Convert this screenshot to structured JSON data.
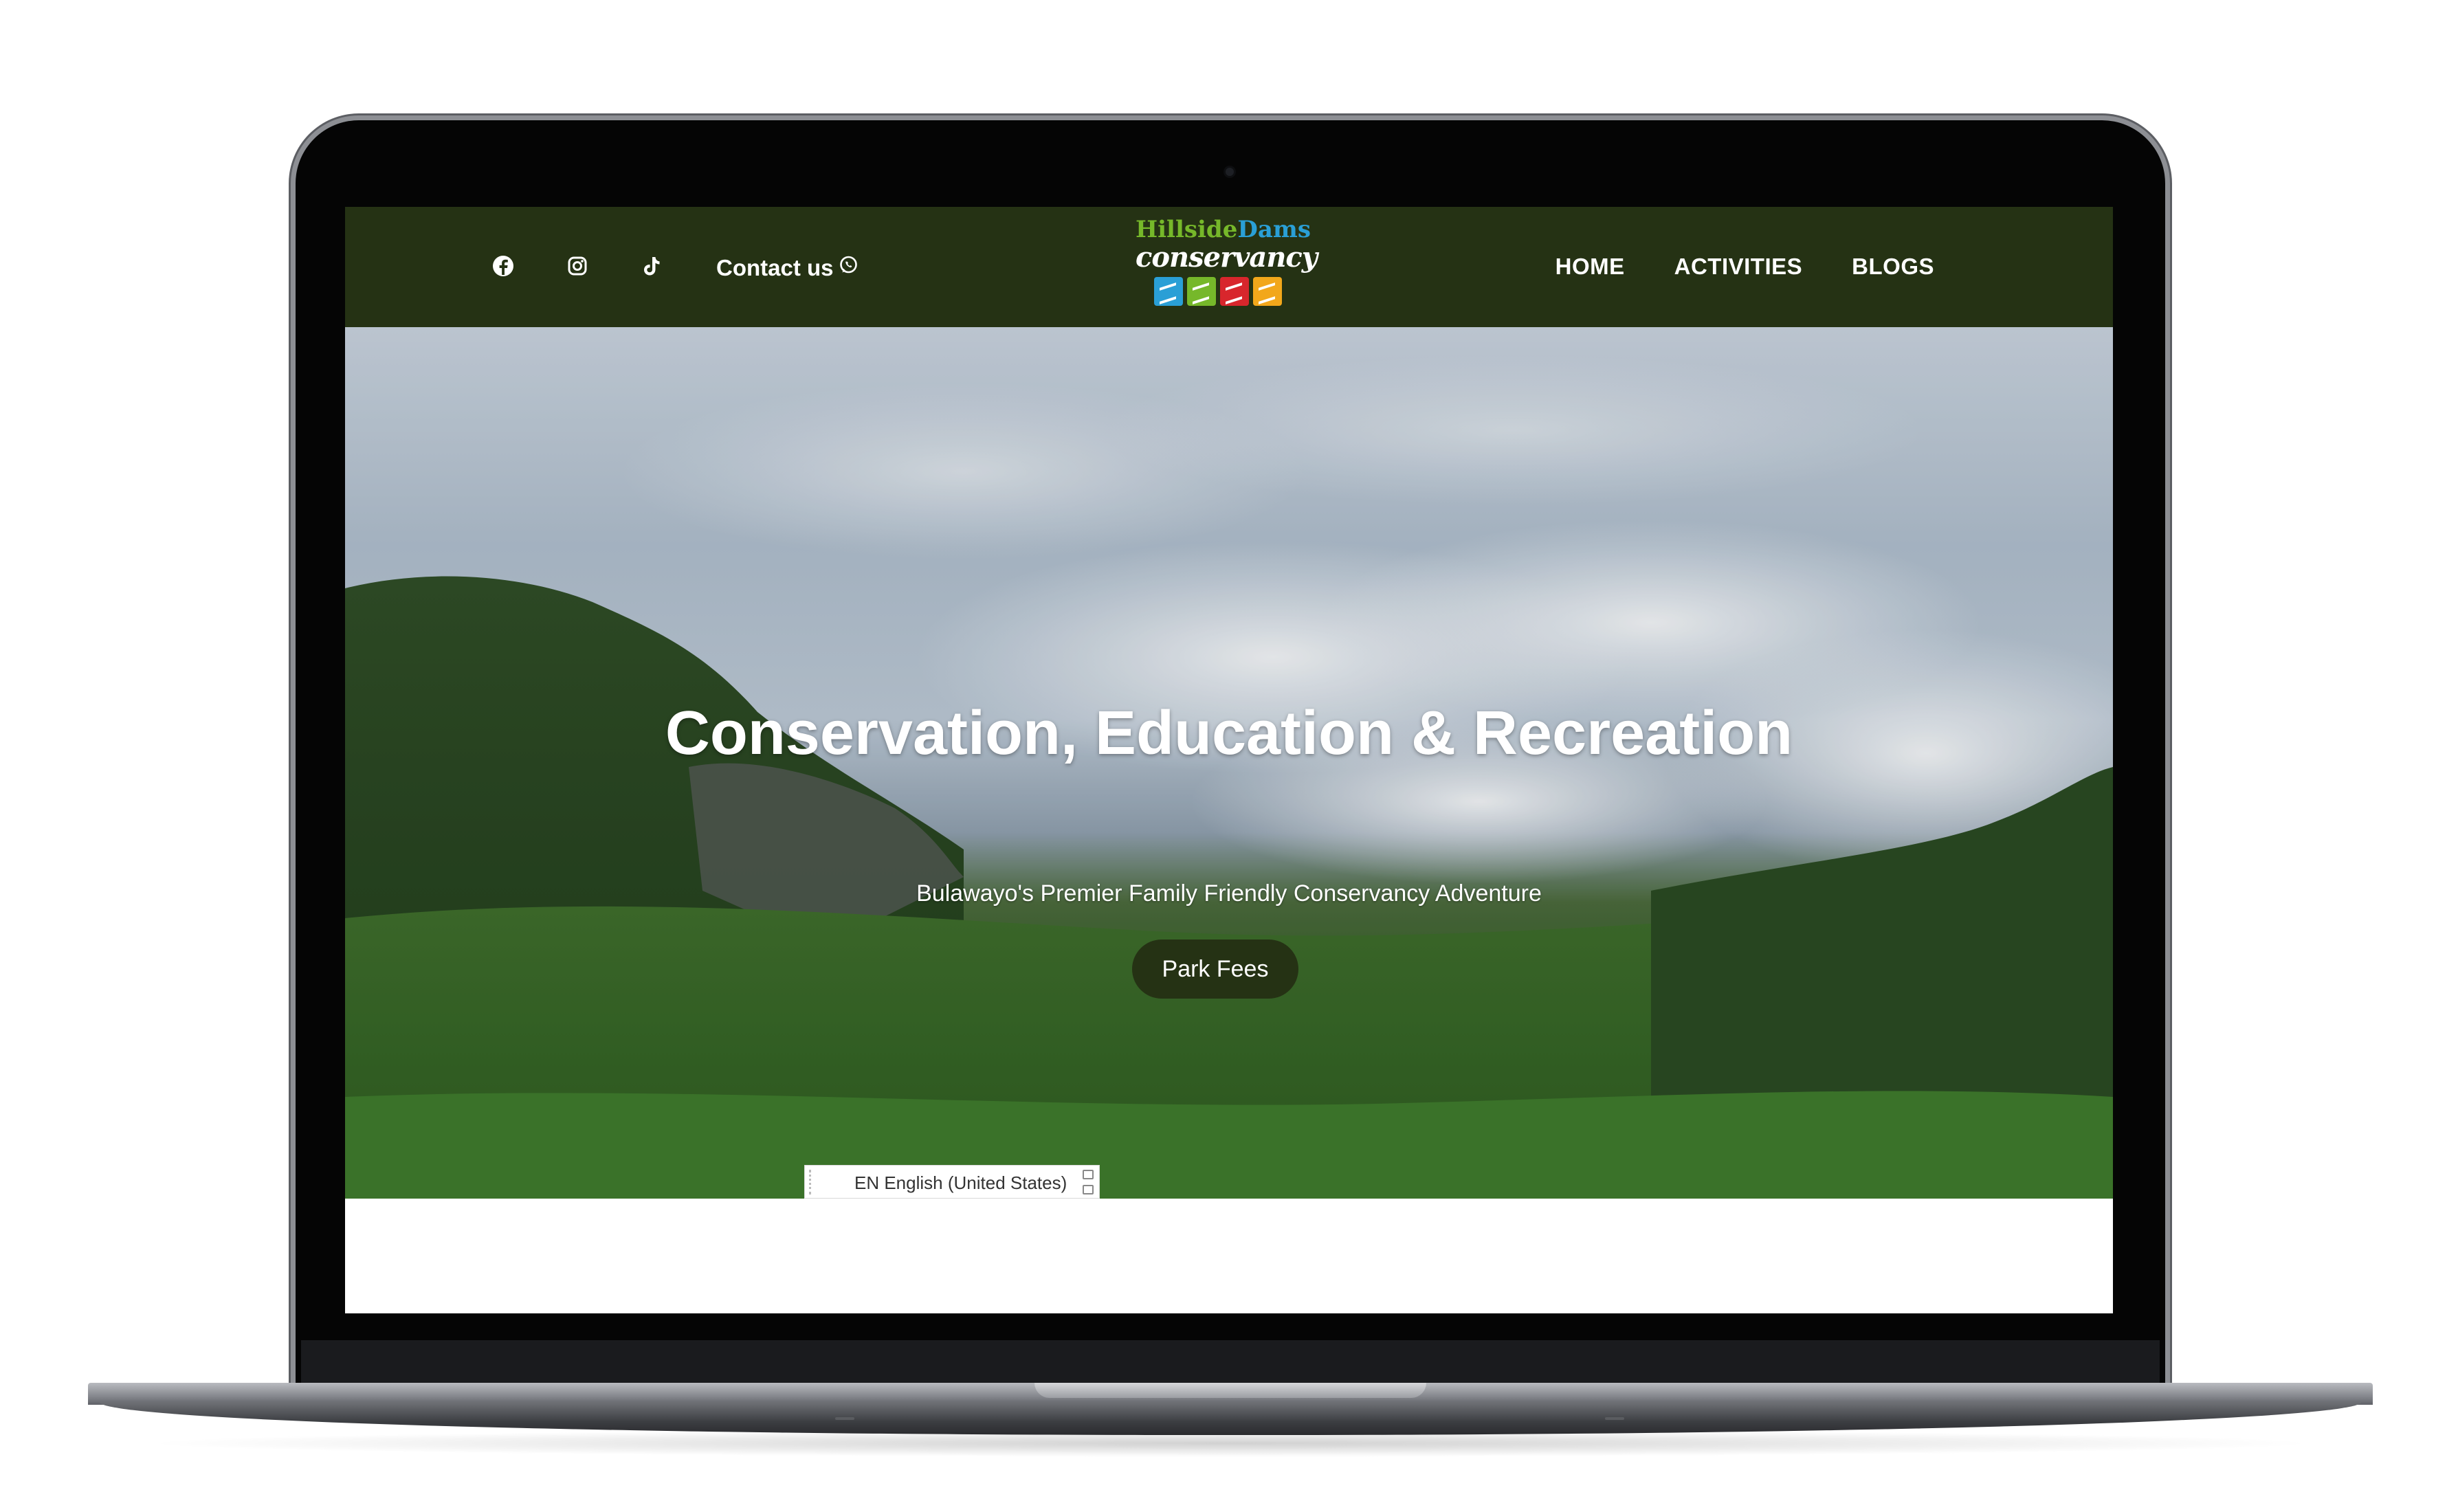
{
  "header": {
    "social": [
      {
        "name": "facebook-icon"
      },
      {
        "name": "instagram-icon"
      },
      {
        "name": "tiktok-icon"
      }
    ],
    "contact_label": "Contact us",
    "contact_icon": "whatsapp-icon",
    "logo": {
      "line1_part1": "Hillside",
      "line1_part2": "Dams",
      "line2": "conservancy",
      "colors": {
        "green": "#76b82a",
        "blue": "#2a9fd6",
        "red": "#d8262c",
        "orange": "#f2a71b"
      }
    },
    "nav": [
      {
        "label": "HOME"
      },
      {
        "label": "ACTIVITIES"
      },
      {
        "label": "BLOGS"
      }
    ],
    "background_color": "#253214"
  },
  "hero": {
    "title": "Conservation, Education & Recreation",
    "subtitle": "Bulawayo's Premier Family Friendly Conservancy Adventure",
    "cta_label": "Park Fees"
  },
  "language_bar": {
    "label": "EN English (United States)"
  }
}
